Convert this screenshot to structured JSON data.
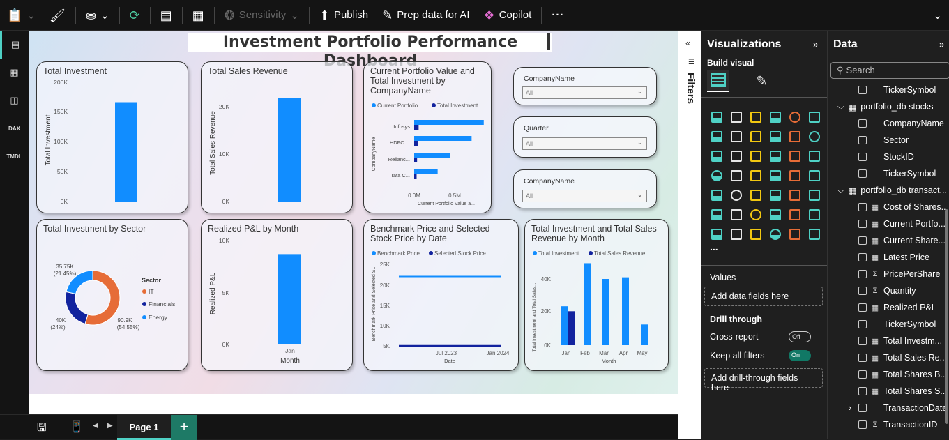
{
  "toolbar": {
    "sensitivity_label": "Sensitivity",
    "publish_label": "Publish",
    "prep_data_label": "Prep data for AI",
    "copilot_label": "Copilot",
    "more_label": "···"
  },
  "left_rail": {
    "dax_label": "DAX",
    "tmdl_label": "TMDL"
  },
  "report": {
    "title": "Investment Portfolio Performance Dashboard"
  },
  "cards": {
    "total_investment": {
      "title": "Total Investment",
      "ylabel": "Total Investment",
      "ticks": [
        "200K",
        "150K",
        "100K",
        "50K",
        "0K"
      ]
    },
    "total_sales": {
      "title": "Total Sales Revenue",
      "ylabel": "Total Sales Revenue",
      "ticks": [
        "20K",
        "10K",
        "0K"
      ]
    },
    "portfolio": {
      "title": "Current Portfolio Value and Total Investment by CompanyName",
      "legend": [
        "Current Portfolio ...",
        "Total Investment"
      ],
      "categories": [
        "Infosys",
        "HDFC ...",
        "Relianc...",
        "Tata C..."
      ],
      "ylabel": "CompanyName",
      "xticks": [
        "0.0M",
        "0.5M"
      ],
      "xlabel": "Current Portfolio Value a..."
    },
    "sector": {
      "title": "Total Investment by Sector",
      "legend_title": "Sector",
      "legend": [
        "IT",
        "Financials",
        "Energy"
      ],
      "label_energy": [
        "35.75K",
        "(21.45%)"
      ],
      "label_fin": [
        "40K",
        "(24%)"
      ],
      "label_it": [
        "90.9K",
        "(54.55%)"
      ]
    },
    "pnl": {
      "title": "Realized P&L by Month",
      "ylabel": "Realized P&L",
      "ticks": [
        "10K",
        "5K",
        "0K"
      ],
      "xtick": "Jan",
      "xlabel": "Month"
    },
    "benchmark": {
      "title": "Benchmark Price and Selected Stock Price by Date",
      "legend": [
        "Benchmark Price",
        "Selected Stock Price"
      ],
      "ylabel": "Benchmark Price and Selected S...",
      "ticks": [
        "25K",
        "20K",
        "15K",
        "10K",
        "5K"
      ],
      "xticks": [
        "Jul 2023",
        "Jan 2024"
      ],
      "xlabel": "Date"
    },
    "inv_sales": {
      "title": "Total Investment and Total Sales Revenue by Month",
      "legend": [
        "Total Investment",
        "Total Sales Revenue"
      ],
      "ylabel": "Total Investment and Total Sales...",
      "ticks": [
        "40K",
        "20K",
        "0K"
      ],
      "xticks": [
        "Jan",
        "Feb",
        "Mar",
        "Apr",
        "May"
      ],
      "xlabel": "Month"
    }
  },
  "slicers": [
    {
      "label": "CompanyName",
      "value": "All"
    },
    {
      "label": "Quarter",
      "value": "All"
    },
    {
      "label": "CompanyName",
      "value": "All"
    }
  ],
  "bottom": {
    "page_tab": "Page 1",
    "add_label": "+"
  },
  "filters_pane": {
    "label": "Filters"
  },
  "visualizations": {
    "title": "Visualizations",
    "build_visual": "Build visual",
    "values_label": "Values",
    "values_well": "Add data fields here",
    "drill_through": "Drill through",
    "cross_report": "Cross-report",
    "cross_report_state": "Off",
    "keep_all_filters": "Keep all filters",
    "keep_all_filters_state": "On",
    "drill_well": "Add drill-through fields here",
    "more": "..."
  },
  "data_pane": {
    "title": "Data",
    "search_placeholder": "Search",
    "rows": [
      {
        "name": "TickerSymbol",
        "type": "",
        "indent": 2
      },
      {
        "name": "portfolio_db stocks",
        "type": "table",
        "indent": 0
      },
      {
        "name": "CompanyName",
        "type": "",
        "indent": 2
      },
      {
        "name": "Sector",
        "type": "",
        "indent": 2
      },
      {
        "name": "StockID",
        "type": "",
        "indent": 2
      },
      {
        "name": "TickerSymbol",
        "type": "",
        "indent": 2
      },
      {
        "name": "portfolio_db transact...",
        "type": "table",
        "indent": 0
      },
      {
        "name": "Cost of Shares...",
        "type": "calc",
        "indent": 2
      },
      {
        "name": "Current Portfo...",
        "type": "calc",
        "indent": 2
      },
      {
        "name": "Current Share...",
        "type": "calc",
        "indent": 2
      },
      {
        "name": "Latest Price",
        "type": "calc",
        "indent": 2
      },
      {
        "name": "PricePerShare",
        "type": "sum",
        "indent": 2
      },
      {
        "name": "Quantity",
        "type": "sum",
        "indent": 2
      },
      {
        "name": "Realized P&L",
        "type": "calc",
        "indent": 2
      },
      {
        "name": "TickerSymbol",
        "type": "",
        "indent": 2
      },
      {
        "name": "Total Investm...",
        "type": "calc",
        "indent": 2
      },
      {
        "name": "Total Sales Re...",
        "type": "calc",
        "indent": 2
      },
      {
        "name": "Total Shares B...",
        "type": "calc",
        "indent": 2
      },
      {
        "name": "Total Shares S...",
        "type": "calc",
        "indent": 2
      },
      {
        "name": "TransactionDate",
        "type": "",
        "indent": 2,
        "expand": true
      },
      {
        "name": "TransactionID",
        "type": "sum",
        "indent": 2
      }
    ]
  },
  "chart_data": [
    {
      "type": "bar",
      "title": "Total Investment",
      "ylabel": "Total Investment",
      "categories": [
        ""
      ],
      "values": [
        166650
      ],
      "ylim": [
        0,
        200000
      ]
    },
    {
      "type": "bar",
      "title": "Total Sales Revenue",
      "ylabel": "Total Sales Revenue",
      "categories": [
        ""
      ],
      "values": [
        20500
      ],
      "ylim": [
        0,
        25000
      ]
    },
    {
      "type": "bar",
      "title": "Current Portfolio Value and Total Investment by CompanyName",
      "ylabel": "CompanyName",
      "xlabel": "Current Portfolio Value a...",
      "categories": [
        "Infosys",
        "HDFC ...",
        "Relianc...",
        "Tata C..."
      ],
      "series": [
        {
          "name": "Current Portfolio ...",
          "values": [
            860000,
            710000,
            440000,
            290000
          ]
        },
        {
          "name": "Total Investment",
          "values": [
            55000,
            45000,
            36000,
            30000
          ]
        }
      ],
      "xlim": [
        0,
        1100000
      ]
    },
    {
      "type": "pie",
      "title": "Total Investment by Sector",
      "categories": [
        "IT",
        "Financials",
        "Energy"
      ],
      "values": [
        90900,
        40000,
        35750
      ]
    },
    {
      "type": "bar",
      "title": "Realized P&L by Month",
      "ylabel": "Realized P&L",
      "xlabel": "Month",
      "categories": [
        "Jan"
      ],
      "values": [
        8700
      ],
      "ylim": [
        0,
        10000
      ]
    },
    {
      "type": "line",
      "title": "Benchmark Price and Selected Stock Price by Date",
      "ylabel": "Benchmark Price and Selected S...",
      "xlabel": "Date",
      "x": [
        "2023-01",
        "2024-04"
      ],
      "series": [
        {
          "name": "Benchmark Price",
          "values": [
            22000,
            22000
          ]
        },
        {
          "name": "Selected Stock Price",
          "values": [
            5000,
            5000
          ]
        }
      ],
      "ylim": [
        5000,
        25000
      ]
    },
    {
      "type": "bar",
      "title": "Total Investment and Total Sales Revenue by Month",
      "ylabel": "Total Investment and Total Sales...",
      "xlabel": "Month",
      "categories": [
        "Jan",
        "Feb",
        "Mar",
        "Apr",
        "May"
      ],
      "series": [
        {
          "name": "Total Investment",
          "values": [
            23500,
            49500,
            40000,
            41000,
            12500
          ]
        },
        {
          "name": "Total Sales Revenue",
          "values": [
            20500,
            0,
            0,
            0,
            0
          ]
        }
      ],
      "ylim": [
        0,
        52000
      ]
    }
  ]
}
